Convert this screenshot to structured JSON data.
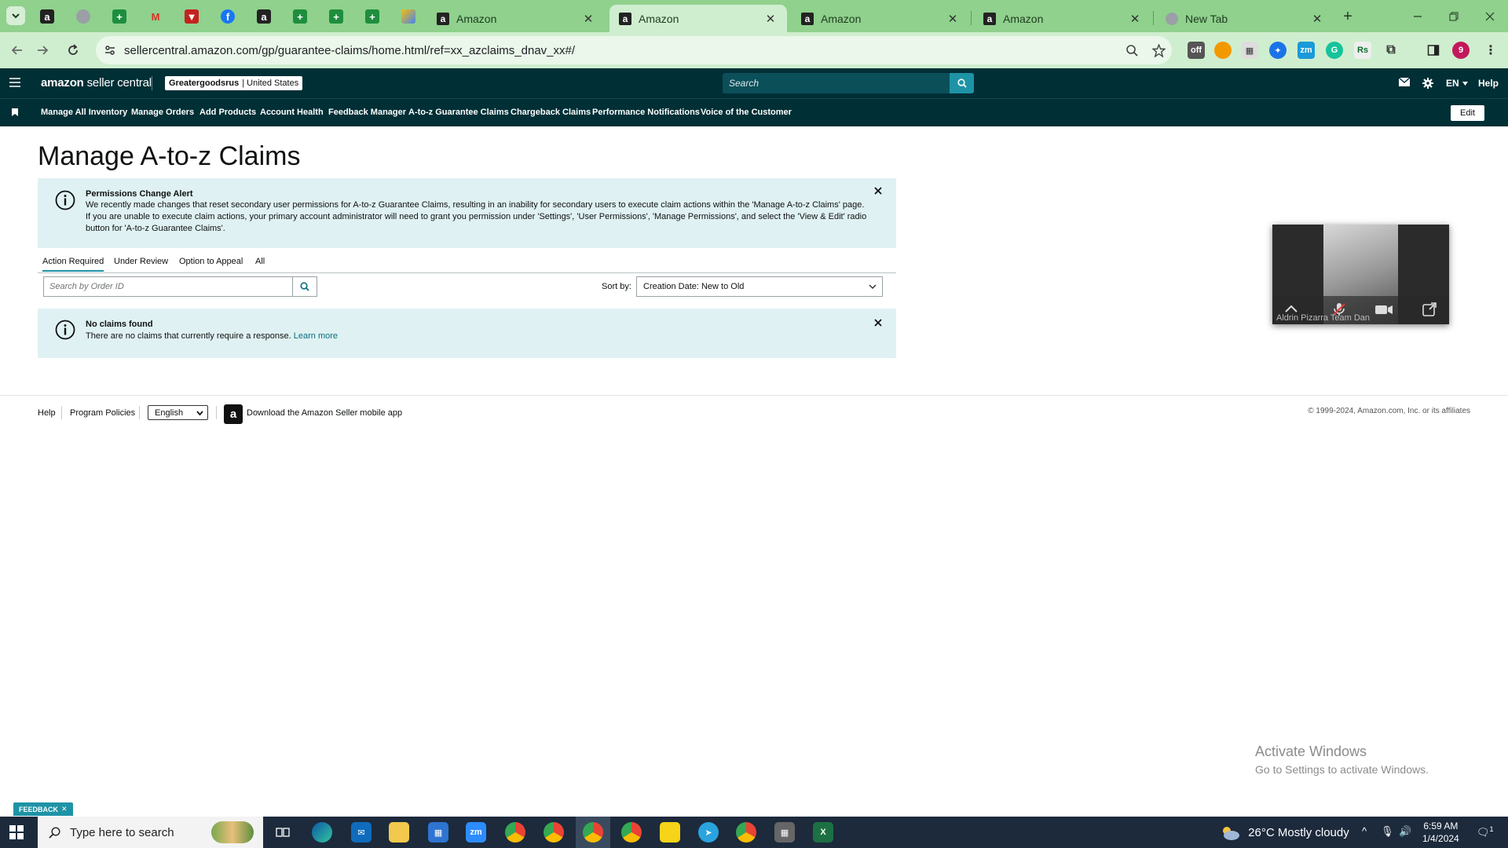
{
  "browser": {
    "tabs": [
      {
        "title": "Amazon",
        "active": false
      },
      {
        "title": "Amazon",
        "active": true
      },
      {
        "title": "Amazon",
        "active": false
      },
      {
        "title": "Amazon",
        "active": false
      },
      {
        "title": "New Tab",
        "active": false
      }
    ],
    "url": "sellercentral.amazon.com/gp/guarantee-claims/home.html/ref=xx_azclaims_dnav_xx#/",
    "new_tab_label": "+",
    "profile_initial": "9"
  },
  "header": {
    "logo_bold": "amazon",
    "logo_light": "seller central",
    "store_name": "Greatergoodsrus",
    "store_region": "United States",
    "search_placeholder": "Search",
    "language": "EN",
    "help": "Help"
  },
  "nav": {
    "items": [
      "Manage All Inventory",
      "Manage Orders",
      "Add Products",
      "Account Health",
      "Feedback Manager",
      "A-to-z Guarantee Claims",
      "Chargeback Claims",
      "Performance Notifications",
      "Voice of the Customer"
    ],
    "edit_label": "Edit"
  },
  "page": {
    "title": "Manage A-to-z Claims",
    "alert": {
      "title": "Permissions Change Alert",
      "body": "We recently made changes that reset secondary user permissions for A-to-z Guarantee Claims, resulting in an inability for secondary users to execute claim actions within the 'Manage A-to-z Claims' page. If you are unable to execute claim actions, your primary account administrator will need to grant you permission under 'Settings', 'User Permissions', 'Manage Permissions', and select the 'View & Edit' radio button for 'A-to-z Guarantee Claims'."
    },
    "tabs": [
      "Action Required",
      "Under Review",
      "Option to Appeal",
      "All"
    ],
    "search_placeholder": "Search by Order ID",
    "sort_label": "Sort by:",
    "sort_value": "Creation Date: New to Old",
    "empty": {
      "title": "No claims found",
      "body": "There are no claims that currently require a response.",
      "link": "Learn more"
    }
  },
  "footer": {
    "help": "Help",
    "policies": "Program Policies",
    "language": "English",
    "app_text": "Download the Amazon Seller mobile app",
    "copyright": "© 1999-2024, Amazon.com, Inc. or its affiliates"
  },
  "video_call": {
    "caller": "Aldrin Pizarra Team Dan"
  },
  "watermark": {
    "line1": "Activate Windows",
    "line2": "Go to Settings to activate Windows."
  },
  "feedback_label": "FEEDBACK",
  "taskbar": {
    "search_placeholder": "Type here to search",
    "weather": "26°C  Mostly cloudy",
    "time": "6:59 AM",
    "date": "1/4/2024",
    "notification_count": "1",
    "zoom_label": "zm"
  },
  "colors": {
    "header_bg": "#002f36",
    "accent": "#1e93a6",
    "alert_bg": "#dff1f3",
    "tabstrip_bg": "#8fd18d"
  }
}
